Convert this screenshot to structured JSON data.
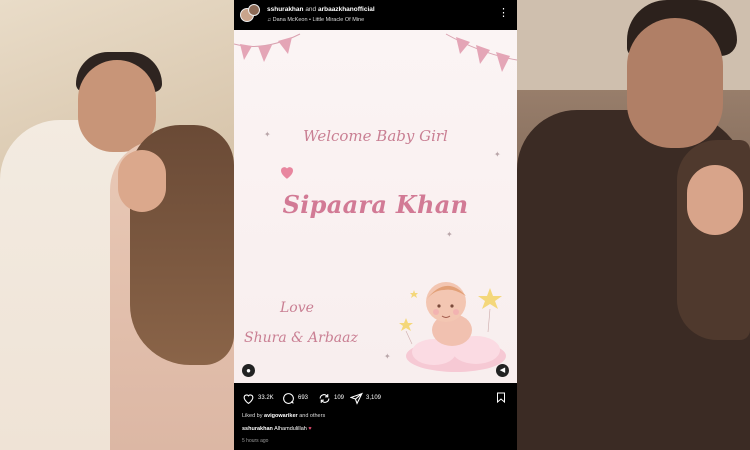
{
  "post": {
    "author_primary": "sshurakhan",
    "author_joiner": "and",
    "author_secondary": "arbaazkhanofficial",
    "music": "Dana McKeon • Little Miracle Of Mine",
    "card": {
      "welcome": "Welcome Baby Girl",
      "baby_name": "Sipaara Khan",
      "love": "Love",
      "signers": "Shura & Arbaaz"
    },
    "actions": {
      "likes": "33.2K",
      "comments": "693",
      "reposts": "109",
      "shares": "3,109"
    },
    "liked_by_prefix": "Liked by",
    "liked_by_user": "avigowariker",
    "liked_by_suffix": "and others",
    "caption_user": "sshurakhan",
    "caption_text": "Alhamdulillah",
    "timestamp": "5 hours ago"
  },
  "colors": {
    "card_text": "#c97f93",
    "name_text": "#d27a95",
    "bunting": "#e4a5b6",
    "heart": "#e8869f"
  },
  "icons": [
    "heart-icon",
    "comment-icon",
    "repost-icon",
    "share-icon",
    "bookmark-icon",
    "more-icon",
    "music-icon",
    "profile-icon",
    "mute-icon"
  ]
}
